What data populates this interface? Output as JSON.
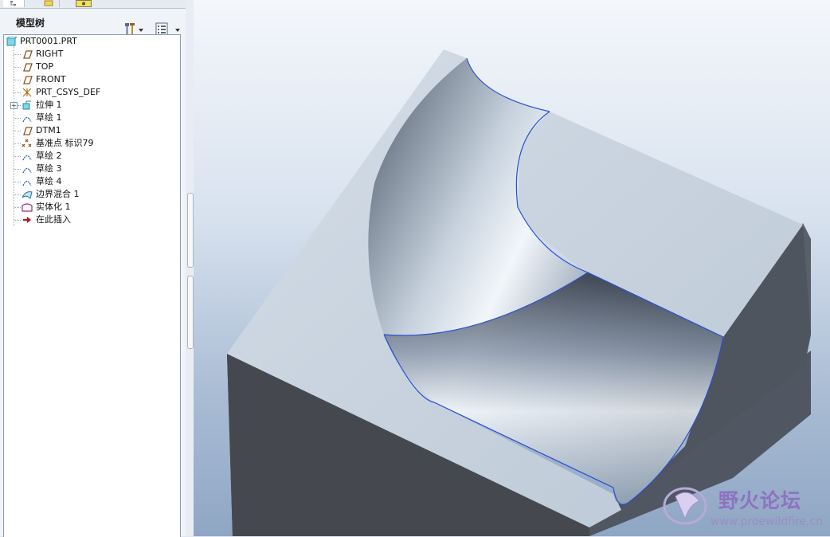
{
  "panel": {
    "title": "模型树",
    "tabs": [
      "tab-model-tree",
      "tab-folder",
      "tab-favorites"
    ]
  },
  "tree": {
    "items": [
      {
        "label": "PRT0001.PRT",
        "icon": "part-icon",
        "depth": 0
      },
      {
        "label": "RIGHT",
        "icon": "datum-plane-icon",
        "depth": 1
      },
      {
        "label": "TOP",
        "icon": "datum-plane-icon",
        "depth": 1
      },
      {
        "label": "FRONT",
        "icon": "datum-plane-icon",
        "depth": 1
      },
      {
        "label": "PRT_CSYS_DEF",
        "icon": "coordinate-system-icon",
        "depth": 1
      },
      {
        "label": "拉伸 1",
        "icon": "extrude-icon",
        "depth": 1,
        "expandable": true
      },
      {
        "label": "草绘 1",
        "icon": "sketch-icon",
        "depth": 1
      },
      {
        "label": "DTM1",
        "icon": "datum-plane-icon",
        "depth": 1
      },
      {
        "label": "基准点 标识79",
        "icon": "datum-point-icon",
        "depth": 1
      },
      {
        "label": "草绘 2",
        "icon": "sketch-icon",
        "depth": 1
      },
      {
        "label": "草绘 3",
        "icon": "sketch-icon",
        "depth": 1
      },
      {
        "label": "草绘 4",
        "icon": "sketch-icon",
        "depth": 1
      },
      {
        "label": "边界混合 1",
        "icon": "boundary-blend-icon",
        "depth": 1
      },
      {
        "label": "实体化 1",
        "icon": "solidify-icon",
        "depth": 1
      },
      {
        "label": "在此插入",
        "icon": "insert-here-arrow-icon",
        "depth": 1
      }
    ]
  },
  "toolbar": {
    "settings_icon": "settings-hammer-icon",
    "show_icon": "show-list-icon"
  },
  "watermark": {
    "title": "野火论坛",
    "url": "www.proewildfire.cn"
  },
  "colors": {
    "model_face": "#c8d3df",
    "model_side": "#4a4f56",
    "edge": "#2a4fd0"
  }
}
